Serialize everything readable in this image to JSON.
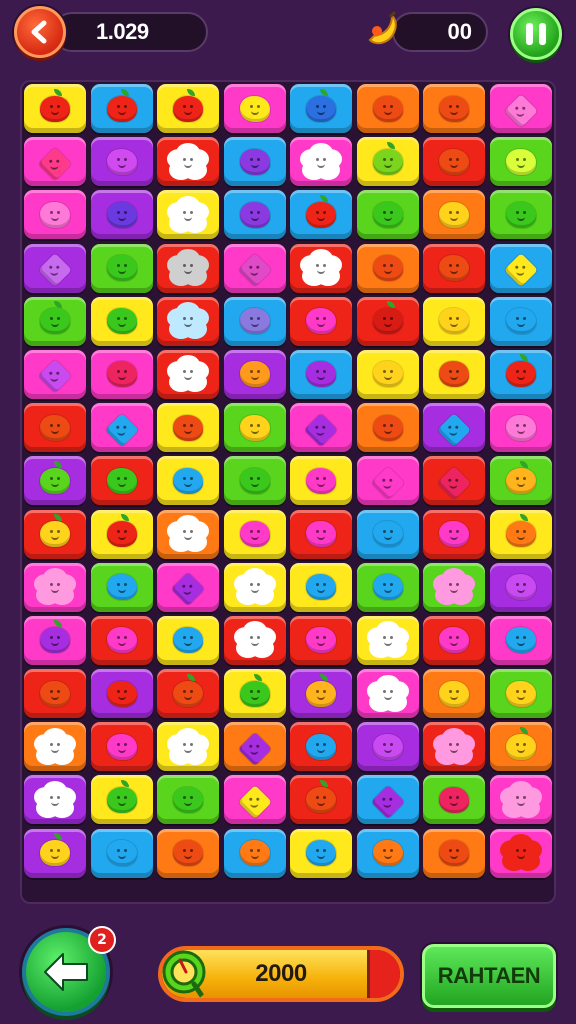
{
  "hud": {
    "score": "1.029",
    "coins": "00",
    "colors": {
      "back": "#e3361a",
      "pause": "#2fb52a"
    }
  },
  "board": {
    "palette": {
      "Y": "#ffe81c",
      "B": "#22a8ef",
      "P": "#ff3ac8",
      "O": "#ff7a14",
      "R": "#ee2418",
      "G": "#58d51c",
      "V": "#a62ee0"
    },
    "rows": [
      [
        [
          "Y",
          "apple",
          "#ee2418"
        ],
        [
          "B",
          "apple",
          "#ee2418"
        ],
        [
          "Y",
          "apple",
          "#ee2418"
        ],
        [
          "P",
          "blob",
          "#ffe81c"
        ],
        [
          "B",
          "apple",
          "#2b6fe0"
        ],
        [
          "O",
          "blob",
          "#ee4a14"
        ],
        [
          "O",
          "blob",
          "#ee4a14"
        ],
        [
          "P",
          "heart",
          "#ff7ad8"
        ]
      ],
      [
        [
          "P",
          "heart",
          "#ff3a8a"
        ],
        [
          "V",
          "blob",
          "#d04af0"
        ],
        [
          "R",
          "flower",
          "#ffffff"
        ],
        [
          "B",
          "blob",
          "#8a3ae0"
        ],
        [
          "P",
          "flower",
          "#ffffff"
        ],
        [
          "Y",
          "apple",
          "#7ad51c"
        ],
        [
          "R",
          "blob",
          "#ee4a14"
        ],
        [
          "G",
          "blob",
          "#d8ff3a"
        ]
      ],
      [
        [
          "P",
          "blob",
          "#ff7ad8"
        ],
        [
          "V",
          "blob",
          "#6a3ae0"
        ],
        [
          "Y",
          "flower",
          "#ffffff"
        ],
        [
          "B",
          "blob",
          "#8a3ae0"
        ],
        [
          "B",
          "apple",
          "#ee2418"
        ],
        [
          "G",
          "blob",
          "#3ac81c"
        ],
        [
          "O",
          "blob",
          "#ffd21c"
        ],
        [
          "G",
          "blob",
          "#3ac81c"
        ]
      ],
      [
        [
          "V",
          "heart",
          "#c86af0"
        ],
        [
          "G",
          "blob",
          "#3ac81c"
        ],
        [
          "R",
          "flower",
          "#cfcfcf"
        ],
        [
          "P",
          "heart",
          "#e04ac8"
        ],
        [
          "R",
          "flower",
          "#ffffff"
        ],
        [
          "O",
          "blob",
          "#ee4a14"
        ],
        [
          "R",
          "blob",
          "#ee4a14"
        ],
        [
          "B",
          "heart",
          "#ffe81c"
        ]
      ],
      [
        [
          "G",
          "apple",
          "#3ac81c"
        ],
        [
          "Y",
          "blob",
          "#3ac81c"
        ],
        [
          "R",
          "flower",
          "#bfe9ff"
        ],
        [
          "B",
          "blob",
          "#8a7ae0"
        ],
        [
          "R",
          "blob",
          "#ff3ac8"
        ],
        [
          "R",
          "apple",
          "#d81c14"
        ],
        [
          "Y",
          "blob",
          "#ffd21c"
        ],
        [
          "B",
          "blob",
          "#22a8ef"
        ]
      ],
      [
        [
          "P",
          "heart",
          "#c84af0"
        ],
        [
          "P",
          "blob",
          "#ee2460"
        ],
        [
          "R",
          "flower",
          "#ffffff"
        ],
        [
          "V",
          "blob",
          "#ff9a1c"
        ],
        [
          "B",
          "blob",
          "#a62ee0"
        ],
        [
          "Y",
          "blob",
          "#ffd21c"
        ],
        [
          "Y",
          "blob",
          "#ee4a14"
        ],
        [
          "B",
          "apple",
          "#ee2418"
        ]
      ],
      [
        [
          "R",
          "blob",
          "#ee4a14"
        ],
        [
          "P",
          "heart",
          "#22a8ef"
        ],
        [
          "Y",
          "blob",
          "#ee4a14"
        ],
        [
          "G",
          "blob",
          "#ffd21c"
        ],
        [
          "P",
          "heart",
          "#a62ee0"
        ],
        [
          "O",
          "blob",
          "#ee4a14"
        ],
        [
          "V",
          "heart",
          "#22a8ef"
        ],
        [
          "P",
          "blob",
          "#ff7ad8"
        ]
      ],
      [
        [
          "V",
          "apple",
          "#58d51c"
        ],
        [
          "R",
          "blob",
          "#3ac81c"
        ],
        [
          "Y",
          "blob",
          "#22a8ef"
        ],
        [
          "G",
          "blob",
          "#3ac81c"
        ],
        [
          "Y",
          "blob",
          "#ff3ac8"
        ],
        [
          "P",
          "heart",
          "#ff3ac8"
        ],
        [
          "R",
          "heart",
          "#ee2460"
        ],
        [
          "G",
          "apple",
          "#ffb31c"
        ]
      ],
      [
        [
          "R",
          "apple",
          "#ffd21c"
        ],
        [
          "Y",
          "apple",
          "#ee2418"
        ],
        [
          "O",
          "flower",
          "#ffffff"
        ],
        [
          "Y",
          "blob",
          "#ff3ac8"
        ],
        [
          "R",
          "blob",
          "#ff3ac8"
        ],
        [
          "B",
          "blob",
          "#22a8ef"
        ],
        [
          "R",
          "blob",
          "#ff3ac8"
        ],
        [
          "Y",
          "apple",
          "#ff7a14"
        ]
      ],
      [
        [
          "P",
          "flower",
          "#ff9ae0"
        ],
        [
          "G",
          "blob",
          "#22a8ef"
        ],
        [
          "P",
          "heart",
          "#a62ee0"
        ],
        [
          "Y",
          "flower",
          "#ffffff"
        ],
        [
          "Y",
          "blob",
          "#22a8ef"
        ],
        [
          "G",
          "blob",
          "#22a8ef"
        ],
        [
          "G",
          "flower",
          "#ff9ae0"
        ],
        [
          "V",
          "blob",
          "#c84af0"
        ]
      ],
      [
        [
          "P",
          "apple",
          "#a62ee0"
        ],
        [
          "R",
          "blob",
          "#ff3ac8"
        ],
        [
          "Y",
          "blob",
          "#22a8ef"
        ],
        [
          "R",
          "flower",
          "#ffffff"
        ],
        [
          "R",
          "blob",
          "#ff3ac8"
        ],
        [
          "Y",
          "flower",
          "#ffffff"
        ],
        [
          "R",
          "blob",
          "#ff3ac8"
        ],
        [
          "P",
          "blob",
          "#22a8ef"
        ]
      ],
      [
        [
          "R",
          "blob",
          "#ee4a14"
        ],
        [
          "V",
          "blob",
          "#ee2418"
        ],
        [
          "R",
          "apple",
          "#ee4a14"
        ],
        [
          "Y",
          "apple",
          "#3ac81c"
        ],
        [
          "V",
          "apple",
          "#ffb31c"
        ],
        [
          "P",
          "flower",
          "#ffffff"
        ],
        [
          "O",
          "blob",
          "#ffd21c"
        ],
        [
          "G",
          "blob",
          "#ffd21c"
        ]
      ],
      [
        [
          "O",
          "flower",
          "#ffffff"
        ],
        [
          "R",
          "blob",
          "#ff3ac8"
        ],
        [
          "Y",
          "flower",
          "#ffffff"
        ],
        [
          "O",
          "heart",
          "#a62ee0"
        ],
        [
          "R",
          "blob",
          "#22a8ef"
        ],
        [
          "V",
          "blob",
          "#c84af0"
        ],
        [
          "R",
          "flower",
          "#ff9ae0"
        ],
        [
          "O",
          "apple",
          "#ffd21c"
        ]
      ],
      [
        [
          "V",
          "flower",
          "#ffffff"
        ],
        [
          "Y",
          "apple",
          "#3ac81c"
        ],
        [
          "G",
          "blob",
          "#3ac81c"
        ],
        [
          "P",
          "heart",
          "#ffe81c"
        ],
        [
          "R",
          "apple",
          "#ee4a14"
        ],
        [
          "B",
          "heart",
          "#a62ee0"
        ],
        [
          "G",
          "blob",
          "#ee2460"
        ],
        [
          "P",
          "flower",
          "#ff9ae0"
        ]
      ],
      [
        [
          "V",
          "apple",
          "#ffd21c"
        ],
        [
          "B",
          "blob",
          "#22a8ef"
        ],
        [
          "O",
          "blob",
          "#ee4a14"
        ],
        [
          "B",
          "blob",
          "#ff7a14"
        ],
        [
          "Y",
          "blob",
          "#22a8ef"
        ],
        [
          "B",
          "blob",
          "#ff7a14"
        ],
        [
          "O",
          "blob",
          "#ee4a14"
        ],
        [
          "P",
          "flower",
          "#ee2418"
        ]
      ]
    ]
  },
  "footer": {
    "undo_badge": "2",
    "progress_text": "2000",
    "progress_fraction": 0.86,
    "action_label": "RAHTAEN"
  }
}
